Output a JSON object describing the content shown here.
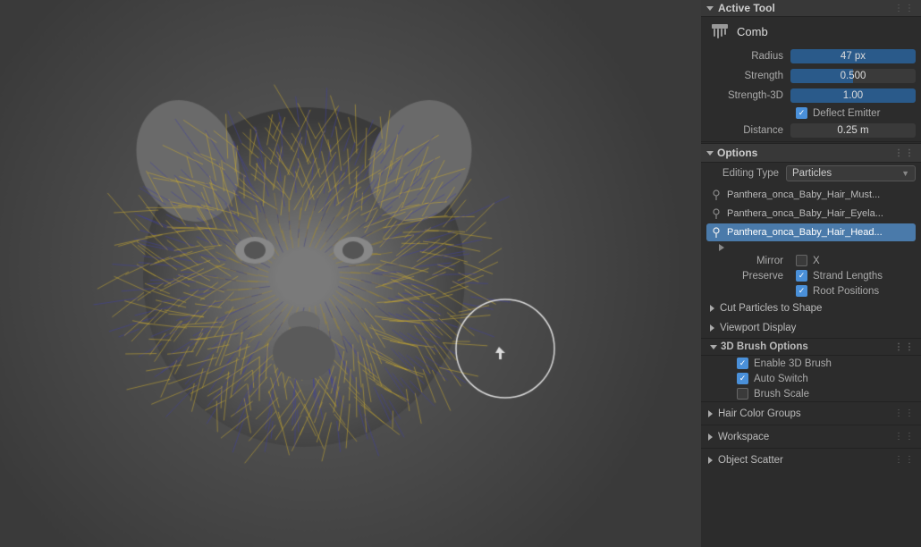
{
  "viewport": {
    "description": "3D viewport showing jaguar cub head with hair particles"
  },
  "active_tool": {
    "section_label": "Active Tool",
    "tool_name": "Comb",
    "radius_label": "Radius",
    "radius_value": "47 px",
    "strength_label": "Strength",
    "strength_value": "0.500",
    "strength3d_label": "Strength-3D",
    "strength3d_value": "1.00",
    "deflect_emitter_label": "Deflect Emitter",
    "deflect_emitter_checked": true,
    "distance_label": "Distance",
    "distance_value": "0.25 m"
  },
  "options": {
    "section_label": "Options",
    "editing_type_label": "Editing Type",
    "editing_type_value": "Particles",
    "particle_items": [
      {
        "name": "Panthera_onca_Baby_Hair_Must...",
        "active": false
      },
      {
        "name": "Panthera_onca_Baby_Hair_Eyela...",
        "active": false
      },
      {
        "name": "Panthera_onca_Baby_Hair_Head...",
        "active": true
      }
    ],
    "mirror_label": "Mirror",
    "mirror_axis": "X",
    "preserve_label": "Preserve",
    "strand_lengths_label": "Strand Lengths",
    "strand_lengths_checked": true,
    "root_positions_label": "Root Positions",
    "root_positions_checked": true
  },
  "cut_particles": {
    "label": "Cut Particles to Shape"
  },
  "viewport_display": {
    "label": "Viewport Display"
  },
  "brush_options": {
    "section_label": "3D Brush Options",
    "enable_3d_brush_label": "Enable 3D Brush",
    "enable_3d_brush_checked": true,
    "auto_switch_label": "Auto Switch",
    "auto_switch_checked": true,
    "brush_scale_label": "Brush Scale",
    "brush_scale_checked": false
  },
  "hair_color_groups": {
    "label": "Hair Color Groups"
  },
  "workspace": {
    "label": "Workspace"
  },
  "object_scatter": {
    "label": "Object Scatter"
  }
}
